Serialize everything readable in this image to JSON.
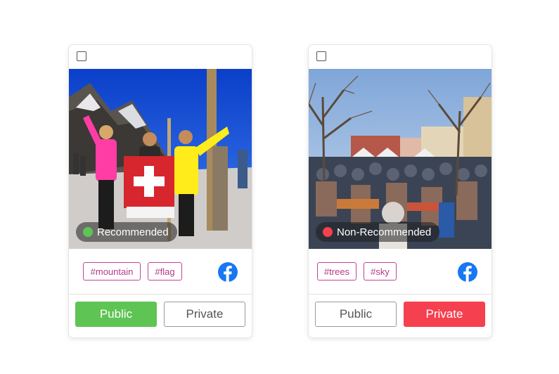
{
  "cards": [
    {
      "status": {
        "label": "Recommended",
        "color": "#5ec453"
      },
      "tags": [
        "#mountain",
        "#flag"
      ],
      "social_icon": "facebook-icon",
      "buttons": {
        "public": "Public",
        "private": "Private",
        "active": "public"
      },
      "photo_icon": "mountain-photo"
    },
    {
      "status": {
        "label": "Non-Recommended",
        "color": "#f5404f"
      },
      "tags": [
        "#trees",
        "#sky"
      ],
      "social_icon": "facebook-icon",
      "buttons": {
        "public": "Public",
        "private": "Private",
        "active": "private"
      },
      "photo_icon": "crowd-photo"
    }
  ],
  "colors": {
    "facebook": "#1877f2",
    "tag_border": "#c2439a",
    "recommended": "#5ec453",
    "non_recommended": "#f5404f"
  }
}
